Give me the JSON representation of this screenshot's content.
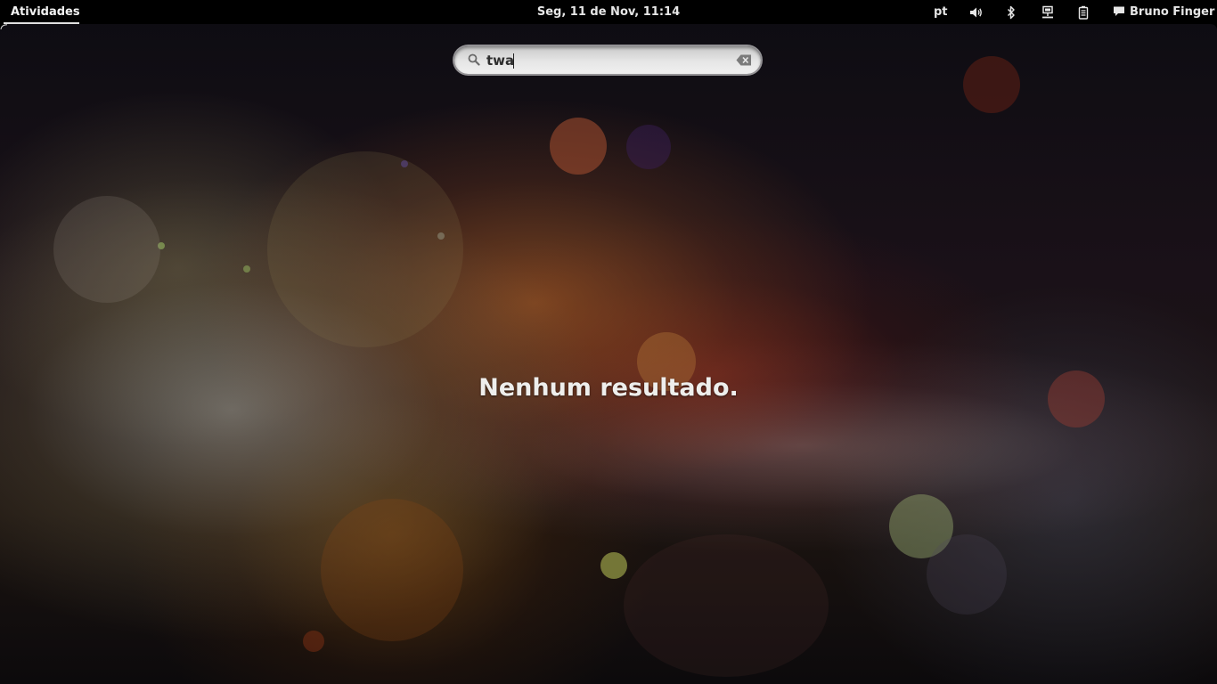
{
  "top_bar": {
    "activities_label": "Atividades",
    "clock": "Seg, 11 de Nov, 11:14",
    "keyboard_layout": "pt",
    "user_name": "Bruno Finger",
    "tray_icons": [
      "volume-icon",
      "bluetooth-icon",
      "network-wired-icon",
      "battery-icon",
      "chat-icon"
    ]
  },
  "search": {
    "query": "twa",
    "search_icon": "search-icon",
    "clear_icon": "clear-icon"
  },
  "results": {
    "empty_message": "Nenhum resultado."
  },
  "colors": {
    "top_bar_bg": "#000000",
    "top_bar_text": "#e6e6e6",
    "search_bg": "#e6e6e6",
    "message_text": "#eeeeec"
  }
}
